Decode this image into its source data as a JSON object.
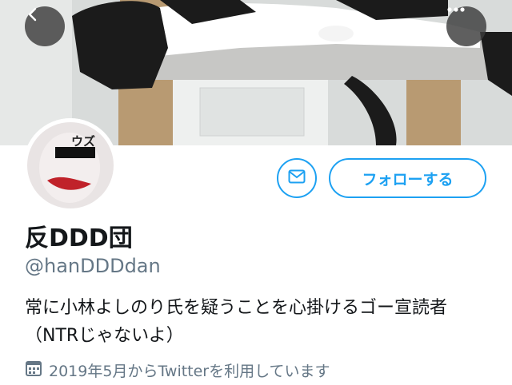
{
  "profile": {
    "display_name": "反DDD団",
    "handle": "@hanDDDdan",
    "bio": "常に小林よしのり氏を疑うことを心掛けるゴー宣読者 （NTRじゃないよ）",
    "joined": "2019年5月からTwitterを利用しています",
    "avatar_text": "ウズ"
  },
  "actions": {
    "follow_label": "フォローする"
  },
  "colors": {
    "accent": "#1da1f2",
    "secondary_text": "#657786"
  },
  "icons": {
    "back": "chevron-left-icon",
    "more": "more-dots-icon",
    "message": "envelope-icon",
    "calendar": "calendar-icon"
  }
}
